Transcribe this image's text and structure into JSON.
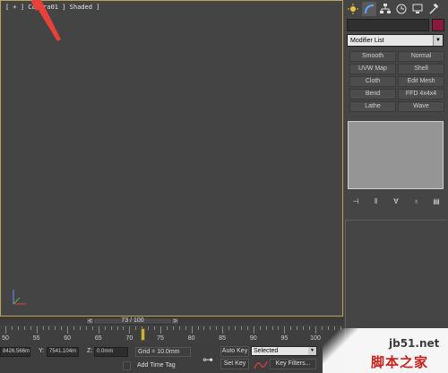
{
  "viewport": {
    "label": "[ + ] Camera01 ] Shaded ]"
  },
  "command_panel": {
    "tabs": [
      "sun-icon",
      "arc-icon",
      "hierarchy-icon",
      "motion-icon",
      "display-icon",
      "hammer-icon"
    ],
    "name_value": "",
    "object_color": "#8a1a3c",
    "modifier_list": "Modifier List",
    "modifier_buttons": [
      "Smooth",
      "Normal",
      "UVW Map",
      "Shell",
      "Cloth",
      "Edit Mesh",
      "Bend",
      "FFD 4x4x4",
      "Lathe",
      "Wave"
    ]
  },
  "timeline": {
    "slider_value": "73 / 100",
    "prev": "<",
    "next": ">",
    "ticks": [
      "50",
      "55",
      "60",
      "65",
      "70",
      "75",
      "80",
      "85",
      "90",
      "95",
      "100"
    ],
    "current_frame": 73
  },
  "status": {
    "x_value": "8426.566m",
    "y_label": "Y:",
    "y_value": "7541.104m",
    "z_label": "Z:",
    "z_value": "0.0mm",
    "grid": "Grid = 10.0mm",
    "add_time_tag": "Add Time Tag",
    "auto_key": "Auto Key",
    "set_key": "Set Key",
    "selected": "Selected",
    "key_filters": "Key Filters..."
  },
  "watermark": {
    "url": "jb51.net",
    "text": "脚本之家"
  },
  "colors": {
    "viewport_border": "#b8a45a",
    "annotation_arrow": "#e8413a",
    "playhead": "#c8b04a"
  }
}
